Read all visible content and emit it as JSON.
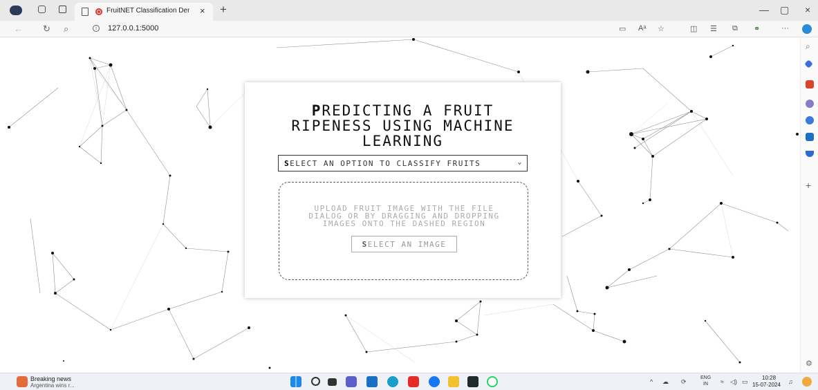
{
  "browser": {
    "tab_title": "FruitNET Classification Demo",
    "tab_close": "×",
    "new_tab": "+",
    "url": "127.0.0.1:5000",
    "window_controls": [
      "—",
      "▢",
      "×"
    ],
    "more": "···"
  },
  "page": {
    "heading_first": "P",
    "heading_rest": "REDICTING A FRUIT",
    "heading_line2": "RIPENESS USING MACHINE",
    "heading_line3": "LEARNING",
    "select_first": "S",
    "select_rest": "ELECT AN OPTION TO CLASSIFY FRUITS",
    "drop_line1": "UPLOAD FRUIT IMAGE WITH THE FILE",
    "drop_line2": "DIALOG OR BY DRAGGING AND DROPPING",
    "drop_line3": "IMAGES ONTO THE DASHED REGION",
    "button_first": "S",
    "button_rest": "ELECT AN IMAGE"
  },
  "taskbar": {
    "news_title": "Breaking news",
    "news_subtitle": "Argentina wins r...",
    "lang_top": "ENG",
    "lang_bottom": "IN",
    "time": "10:28",
    "date": "15-07-2024"
  }
}
